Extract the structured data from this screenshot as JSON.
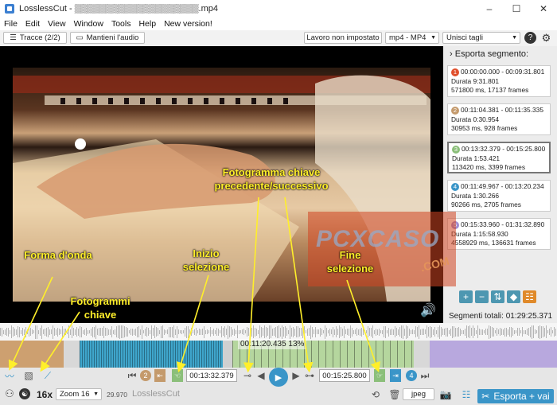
{
  "window": {
    "title": "LosslessCut - ▒▒▒▒▒▒▒▒▒▒▒▒▒▒▒▒▒▒▒▒.mp4",
    "minimize": "–",
    "maximize": "☐",
    "close": "✕"
  },
  "menu": [
    "File",
    "Edit",
    "View",
    "Window",
    "Tools",
    "Help",
    "New version!"
  ],
  "toolbar": {
    "tracks_label": "Tracce (2/2)",
    "audio_label": "Mantieni l'audio",
    "workdir_label": "Lavoro non impostato",
    "format": "mp4 - MP4",
    "merge": "Unisci tagli",
    "help": "?",
    "settings": "⚙"
  },
  "sidebar": {
    "header": "Esporta segmento:",
    "segments": [
      {
        "num": "1",
        "color": "#e0502d",
        "range": "00:00:00.000 - 00:09:31.801",
        "duration": "Durata 9:31.801",
        "detail": "571800 ms, 17137 frames",
        "active": false
      },
      {
        "num": "2",
        "color": "#c49a6c",
        "range": "00:11:04.381 - 00:11:35.335",
        "duration": "Durata 0:30.954",
        "detail": "30953 ms, 928 frames",
        "active": false
      },
      {
        "num": "3",
        "color": "#8bbf7a",
        "range": "00:13:32.379 - 00:15:25.800",
        "duration": "Durata 1:53.421",
        "detail": "113420 ms, 3399 frames",
        "active": true
      },
      {
        "num": "4",
        "color": "#3a95c8",
        "range": "00:11:49.967 - 00:13:20.234",
        "duration": "Durata 1:30.266",
        "detail": "90266 ms, 2705 frames",
        "active": false
      },
      {
        "num": "5",
        "color": "#a08cd0",
        "range": "00:15:33.960 - 01:31:32.890",
        "duration": "Durata 1:15:58.930",
        "detail": "4558929 ms, 136631 frames",
        "active": false
      }
    ],
    "total": "Segmenti totali: 01:29:25.371"
  },
  "timeline": {
    "cursor_time": "00:11:20.435 13%"
  },
  "controls": {
    "seg_prev": "2",
    "seg_next": "4",
    "start_time": "00:13:32.379",
    "end_time": "00:15:25.800",
    "speed": "16x",
    "zoom": "Zoom 16",
    "fps": "29.970",
    "app_name": "LosslessCut",
    "snapshot_format": "jpeg",
    "export_label": "Esporta + vai"
  },
  "annotations": {
    "waveform": "Forma d'onda",
    "keyframes": "Fotogrammi chiave",
    "keyframe_nav": "Fotogramma chiave precedente/successivo",
    "start_sel": "Inizio selezione",
    "end_sel": "Fine selezione"
  },
  "watermark": {
    "text": "PCXCASO",
    "suffix": ".COM"
  },
  "colors": {
    "accent": "#3a95c8",
    "annotation": "#ffef2a"
  }
}
